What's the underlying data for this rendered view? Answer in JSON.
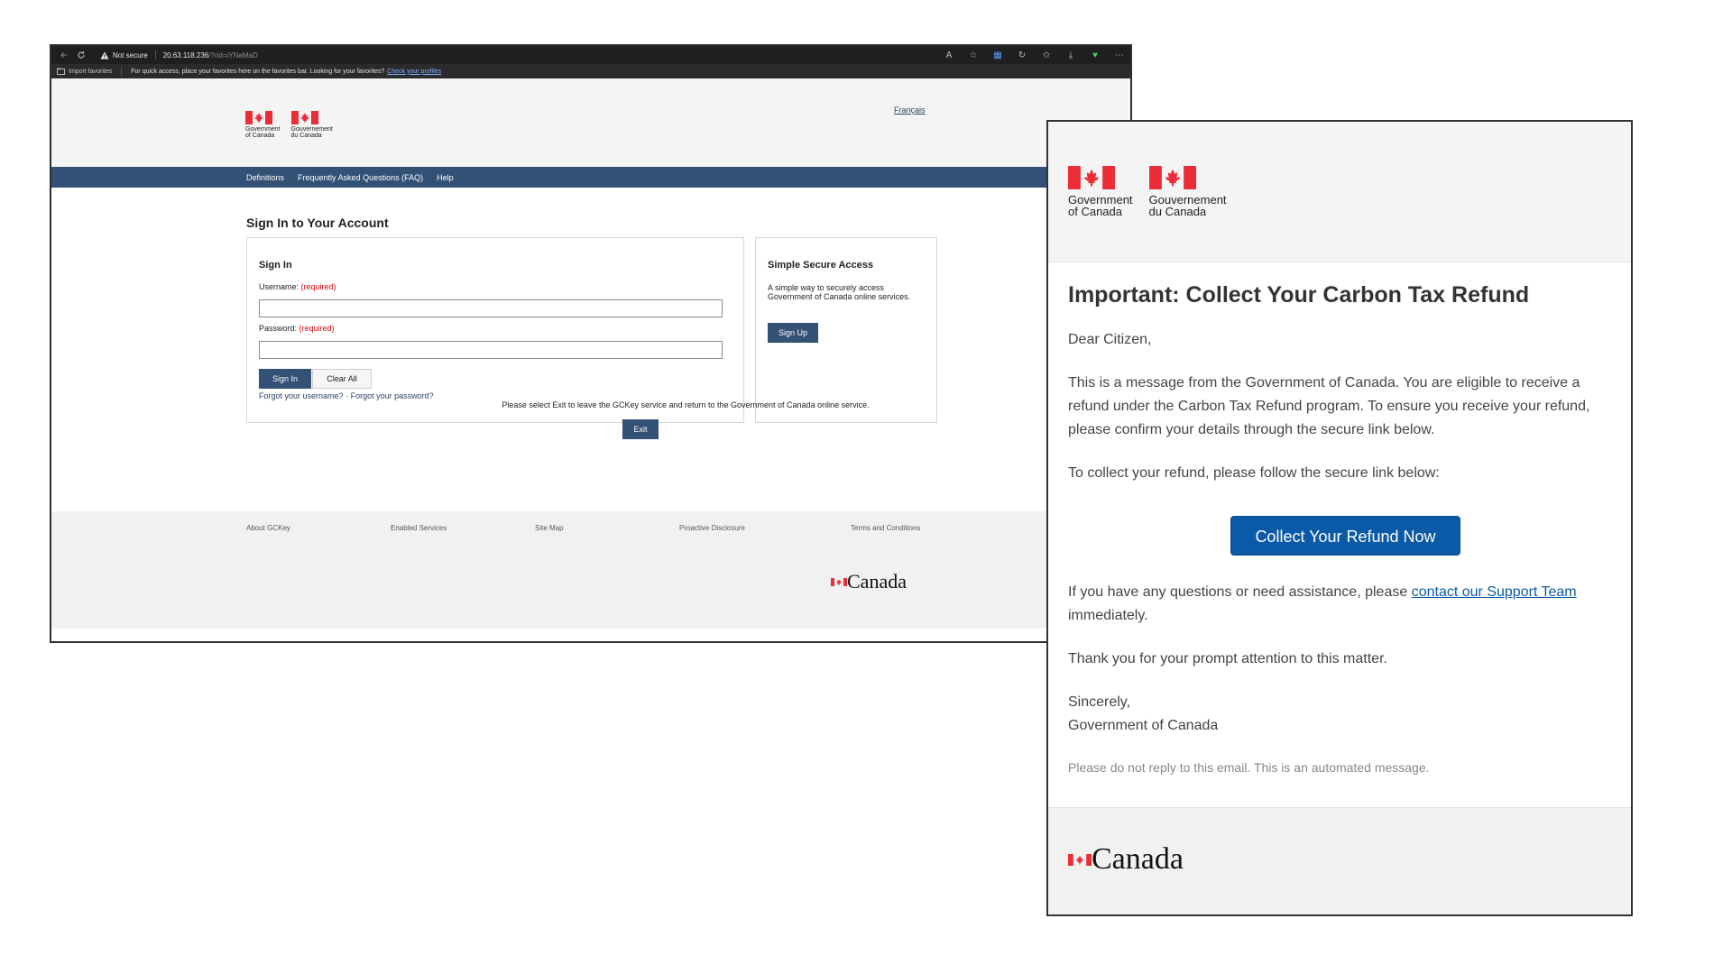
{
  "browser": {
    "security_label": "Not secure",
    "url_host": "20.63.118.236",
    "url_path": "/?rid=iYNaMaD",
    "favorites_import": "Import favorites",
    "favorites_message": "For quick access, place your favorites here on the favorites bar. Looking for your favorites?",
    "favorites_link": "Check your profiles"
  },
  "gckey_page": {
    "signature_en_line1": "Government",
    "signature_en_line2": "of Canada",
    "signature_fr_line1": "Gouvernement",
    "signature_fr_line2": "du Canada",
    "language_link": "Français",
    "nav": [
      "Definitions",
      "Frequently Asked Questions (FAQ)",
      "Help"
    ],
    "page_title": "Sign In to Your Account",
    "signin": {
      "heading": "Sign In",
      "username_label": "Username:",
      "password_label": "Password:",
      "required": "(required)",
      "username_value": "",
      "password_value": "",
      "signin_button": "Sign In",
      "clear_button": "Clear All",
      "forgot_username": "Forgot your username?",
      "separator": "·",
      "forgot_password": "Forgot your password?"
    },
    "ssa": {
      "heading": "Simple Secure Access",
      "description": "A simple way to securely access Government of Canada online services.",
      "signup_button": "Sign Up"
    },
    "exit_text": "Please select Exit to leave the GCKey service and return to the Government of Canada online service.",
    "exit_button": "Exit",
    "footer_links": [
      "About GCKey",
      "Enabled Services",
      "Site Map",
      "Proactive Disclosure",
      "Terms and Conditions"
    ],
    "wordmark": "Canada"
  },
  "email": {
    "signature_en_line1": "Government",
    "signature_en_line2": "of Canada",
    "signature_fr_line1": "Gouvernement",
    "signature_fr_line2": "du Canada",
    "title": "Important: Collect Your Carbon Tax Refund",
    "greeting": "Dear Citizen,",
    "paragraph1": "This is a message from the Government of Canada. You are eligible to receive a refund under the Carbon Tax Refund program. To ensure you receive your refund, please confirm your details through the secure link below.",
    "paragraph2": "To collect your refund, please follow the secure link below:",
    "cta_button": "Collect Your Refund Now",
    "questions_prefix": "If you have any questions or need assistance, please",
    "support_link": "contact our Support Team",
    "questions_suffix": "immediately.",
    "thanks": "Thank you for your prompt attention to this matter.",
    "closing": "Sincerely,",
    "sender": "Government of Canada",
    "note": "Please do not reply to this email. This is an automated message.",
    "wordmark": "Canada"
  },
  "colors": {
    "gc_nav": "#335075",
    "flag_red": "#eb2d37",
    "cta_blue": "#0b5aa8",
    "required_red": "#d3080c"
  }
}
